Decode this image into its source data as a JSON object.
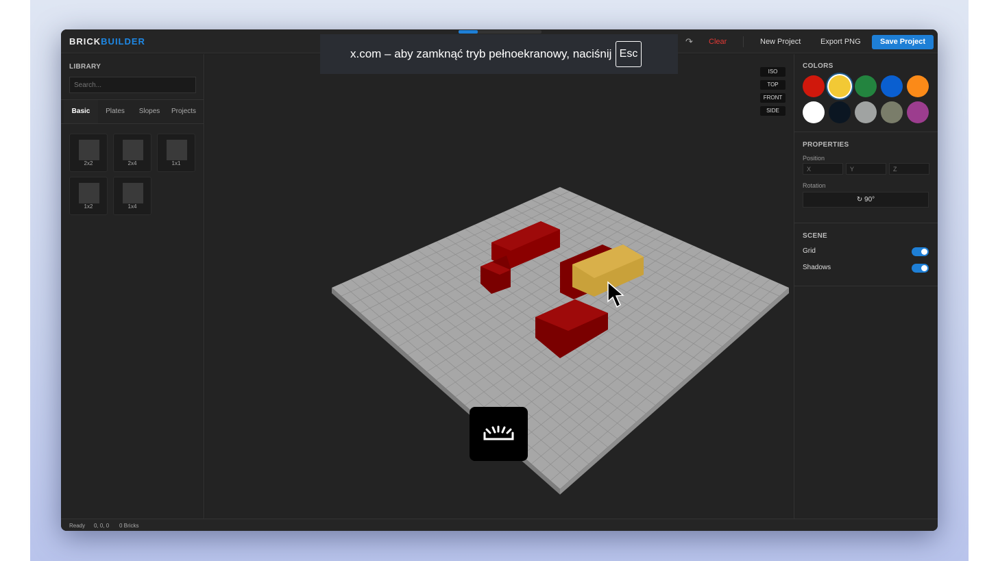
{
  "app": {
    "logo_a": "BRICK",
    "logo_b": "BUILDER"
  },
  "toolbar": {
    "redo_icon": "redo-icon",
    "redo": "↷",
    "clear": "Clear",
    "new_project": "New Project",
    "export_png": "Export PNG",
    "save_project": "Save Project"
  },
  "library": {
    "title": "LIBRARY",
    "search_placeholder": "Search...",
    "tabs": [
      "Basic",
      "Plates",
      "Slopes",
      "Projects"
    ],
    "active_tab": "Basic",
    "parts": [
      "2x2",
      "2x4",
      "1x1",
      "1x2",
      "1x4"
    ]
  },
  "view_buttons": [
    "ISO",
    "TOP",
    "FRONT",
    "SIDE"
  ],
  "colors": {
    "title": "COLORS",
    "selected": "#f2c935",
    "swatches": [
      "#d0180c",
      "#f2c935",
      "#23843f",
      "#0a5fd0",
      "#fb8a18",
      "#ffffff",
      "#0b1622",
      "#a0a3a2",
      "#7a7d6a",
      "#9c3d8e"
    ]
  },
  "properties": {
    "title": "PROPERTIES",
    "position_label": "Position",
    "x_placeholder": "X",
    "y_placeholder": "Y",
    "z_placeholder": "Z",
    "rotation_label": "Rotation",
    "rotation_value": "↻ 90°"
  },
  "scene": {
    "title": "SCENE",
    "grid_label": "Grid",
    "grid_on": true,
    "shadows_label": "Shadows",
    "shadows_on": true
  },
  "status": {
    "state": "Ready",
    "coords": "0, 0, 0",
    "bricks": "0 Bricks"
  },
  "fullscreen_notice": {
    "text": "x.com – aby zamknąć tryb pełnoekranowy, naciśnij",
    "key": "Esc"
  }
}
